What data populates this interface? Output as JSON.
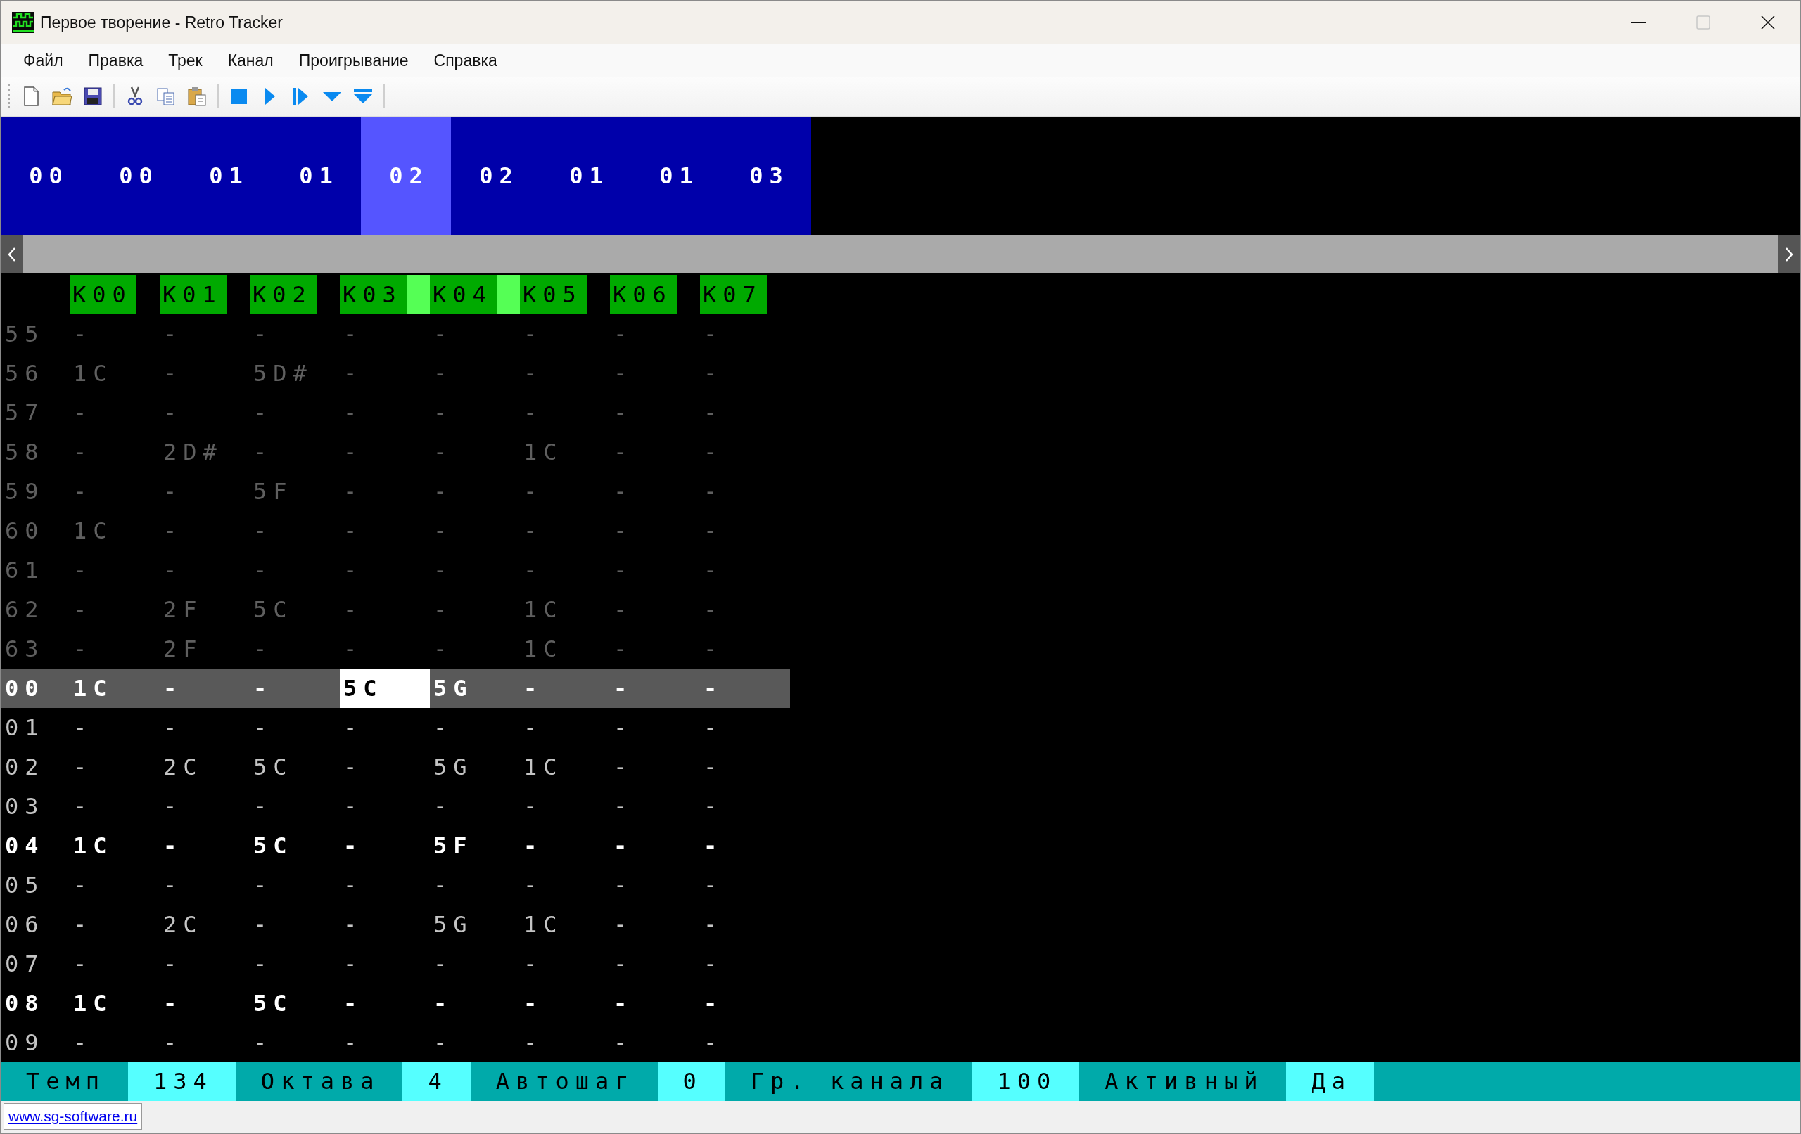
{
  "window": {
    "title": "Первое творение - Retro Tracker"
  },
  "menu": [
    "Файл",
    "Правка",
    "Трек",
    "Канал",
    "Проигрывание",
    "Справка"
  ],
  "order": [
    {
      "text": "00",
      "selected": false
    },
    {
      "text": "00",
      "selected": false
    },
    {
      "text": "01",
      "selected": false
    },
    {
      "text": "01",
      "selected": false
    },
    {
      "text": "02",
      "selected": true
    },
    {
      "text": "02",
      "selected": false
    },
    {
      "text": "01",
      "selected": false
    },
    {
      "text": "01",
      "selected": false
    },
    {
      "text": "03",
      "selected": false
    }
  ],
  "channels": [
    {
      "label": "К00",
      "highlighted": false,
      "cursor": false
    },
    {
      "label": "К01",
      "highlighted": false,
      "cursor": false
    },
    {
      "label": "К02",
      "highlighted": false,
      "cursor": false
    },
    {
      "label": "К03",
      "highlighted": true,
      "cursor": true
    },
    {
      "label": "К04",
      "highlighted": true,
      "cursor": false
    },
    {
      "label": "К05",
      "highlighted": false,
      "cursor": false
    },
    {
      "label": "К06",
      "highlighted": false,
      "cursor": false
    },
    {
      "label": "К07",
      "highlighted": false,
      "cursor": false
    }
  ],
  "rows": [
    {
      "number": "55",
      "kind": "previous",
      "selected": false,
      "cells": [
        "-",
        "-",
        "-",
        "-",
        "-",
        "-",
        "-",
        "-"
      ]
    },
    {
      "number": "56",
      "kind": "previous",
      "selected": false,
      "cells": [
        "1C",
        "-",
        "5D#",
        "-",
        "-",
        "-",
        "-",
        "-"
      ]
    },
    {
      "number": "57",
      "kind": "previous",
      "selected": false,
      "cells": [
        "-",
        "-",
        "-",
        "-",
        "-",
        "-",
        "-",
        "-"
      ]
    },
    {
      "number": "58",
      "kind": "previous",
      "selected": false,
      "cells": [
        "-",
        "2D#",
        "-",
        "-",
        "-",
        "1C",
        "-",
        "-"
      ]
    },
    {
      "number": "59",
      "kind": "previous",
      "selected": false,
      "cells": [
        "-",
        "-",
        "5F",
        "-",
        "-",
        "-",
        "-",
        "-"
      ]
    },
    {
      "number": "60",
      "kind": "previous",
      "selected": false,
      "cells": [
        "1C",
        "-",
        "-",
        "-",
        "-",
        "-",
        "-",
        "-"
      ]
    },
    {
      "number": "61",
      "kind": "previous",
      "selected": false,
      "cells": [
        "-",
        "-",
        "-",
        "-",
        "-",
        "-",
        "-",
        "-"
      ]
    },
    {
      "number": "62",
      "kind": "previous",
      "selected": false,
      "cells": [
        "-",
        "2F",
        "5C",
        "-",
        "-",
        "1C",
        "-",
        "-"
      ]
    },
    {
      "number": "63",
      "kind": "previous",
      "selected": false,
      "cells": [
        "-",
        "2F",
        "-",
        "-",
        "-",
        "1C",
        "-",
        "-"
      ]
    },
    {
      "number": "00",
      "kind": "beat",
      "selected": true,
      "cells": [
        "1C",
        "-",
        "-",
        "5C",
        "5G",
        "-",
        "-",
        "-"
      ]
    },
    {
      "number": "01",
      "kind": "normal",
      "selected": false,
      "cells": [
        "-",
        "-",
        "-",
        "-",
        "-",
        "-",
        "-",
        "-"
      ]
    },
    {
      "number": "02",
      "kind": "normal",
      "selected": false,
      "cells": [
        "-",
        "2C",
        "5C",
        "-",
        "5G",
        "1C",
        "-",
        "-"
      ]
    },
    {
      "number": "03",
      "kind": "normal",
      "selected": false,
      "cells": [
        "-",
        "-",
        "-",
        "-",
        "-",
        "-",
        "-",
        "-"
      ]
    },
    {
      "number": "04",
      "kind": "beat",
      "selected": false,
      "cells": [
        "1C",
        "-",
        "5C",
        "-",
        "5F",
        "-",
        "-",
        "-"
      ]
    },
    {
      "number": "05",
      "kind": "normal",
      "selected": false,
      "cells": [
        "-",
        "-",
        "-",
        "-",
        "-",
        "-",
        "-",
        "-"
      ]
    },
    {
      "number": "06",
      "kind": "normal",
      "selected": false,
      "cells": [
        "-",
        "2C",
        "-",
        "-",
        "5G",
        "1C",
        "-",
        "-"
      ]
    },
    {
      "number": "07",
      "kind": "normal",
      "selected": false,
      "cells": [
        "-",
        "-",
        "-",
        "-",
        "-",
        "-",
        "-",
        "-"
      ]
    },
    {
      "number": "08",
      "kind": "beat",
      "selected": false,
      "cells": [
        "1C",
        "-",
        "5C",
        "-",
        "-",
        "-",
        "-",
        "-"
      ]
    },
    {
      "number": "09",
      "kind": "normal",
      "selected": false,
      "cells": [
        "-",
        "-",
        "-",
        "-",
        "-",
        "-",
        "-",
        "-"
      ]
    }
  ],
  "status": [
    {
      "label": "Темп",
      "value": "134"
    },
    {
      "label": "Октава",
      "value": "4"
    },
    {
      "label": "Автошаг",
      "value": "0"
    },
    {
      "label": "Гр. канала",
      "value": "100"
    },
    {
      "label": "Активный",
      "value": "Да"
    }
  ],
  "footer_link": "www.sg-software.ru"
}
